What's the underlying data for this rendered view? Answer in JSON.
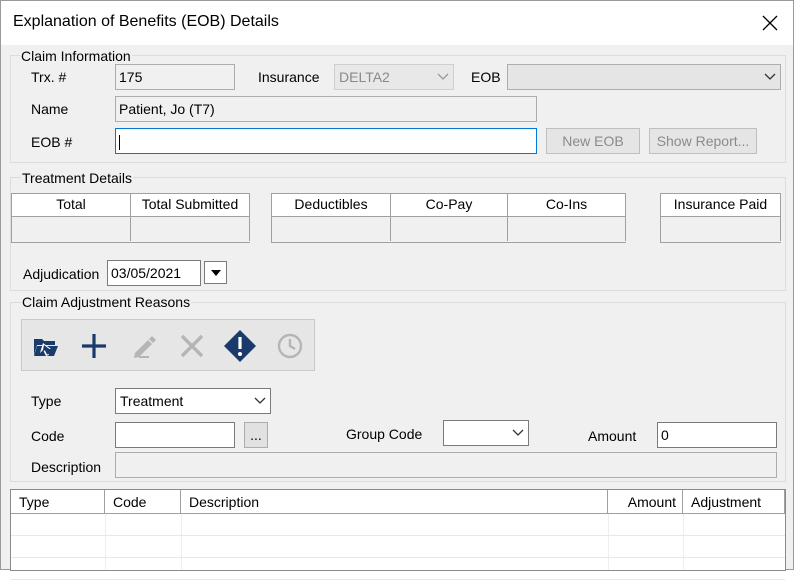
{
  "window": {
    "title": "Explanation of Benefits (EOB) Details"
  },
  "claim_info": {
    "group_label": "Claim Information",
    "trx_label": "Trx. #",
    "trx_value": "175",
    "insurance_label": "Insurance",
    "insurance_value": "DELTA2",
    "eob_label": "EOB",
    "eob_value": "",
    "name_label": "Name",
    "name_value": "Patient, Jo (T7)",
    "eob_no_label": "EOB #",
    "eob_no_value": "",
    "new_eob_button": "New EOB",
    "show_report_button": "Show Report..."
  },
  "treatment": {
    "group_label": "Treatment Details",
    "columns": [
      "Total",
      "Total Submitted",
      "Deductibles",
      "Co-Pay",
      "Co-Ins",
      "Insurance Paid"
    ],
    "adjudication_label": "Adjudication",
    "adjudication_value": "03/05/2021"
  },
  "adjustment": {
    "group_label": "Claim Adjustment Reasons",
    "toolbar_icons": [
      "folder-arrow-icon",
      "plus-icon",
      "edit-pencil-icon",
      "delete-x-icon",
      "alert-diamond-icon",
      "history-clock-icon"
    ],
    "type_label": "Type",
    "type_value": "Treatment",
    "code_label": "Code",
    "code_value": "",
    "code_browse": "...",
    "group_code_label": "Group Code",
    "group_code_value": "",
    "amount_label": "Amount",
    "amount_value": "0",
    "description_label": "Description",
    "description_value": ""
  },
  "list": {
    "columns": [
      "Type",
      "Code",
      "Description",
      "Amount",
      "Adjustment"
    ]
  },
  "colors": {
    "accent_dark": "#1a3a6b",
    "focus_border": "#0078d7"
  }
}
